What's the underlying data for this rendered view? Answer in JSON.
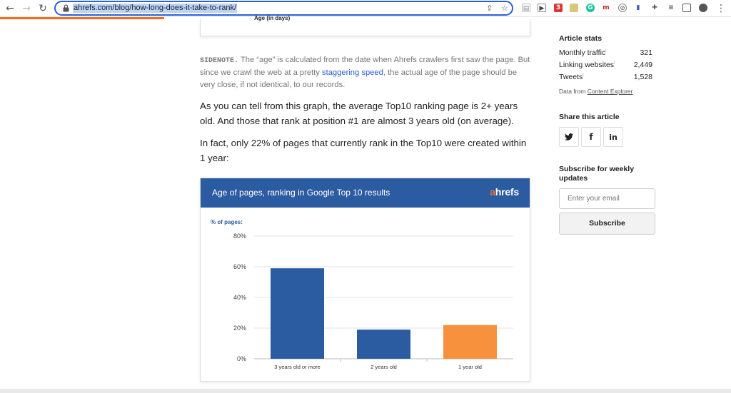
{
  "browser": {
    "url": "ahrefs.com/blog/how-long-does-it-take-to-rank/",
    "ext_badge": "3"
  },
  "figure_prev": {
    "xlabel": "Age (in days)"
  },
  "sidenote": {
    "tag": "SIDENOTE.",
    "text_before": " The “age” is calculated from the date when Ahrefs crawlers first saw the page. But since we crawl the web at a pretty ",
    "link": "staggering speed",
    "text_after": ", the actual age of the page should be very close, if not identical, to our records."
  },
  "article": {
    "p1": "As you can tell from this graph, the average Top10 ranking page is 2+ years old. And those that rank at position #1 are almost 3 years old (on average).",
    "p2": "In fact, only 22% of pages that currently rank in the Top10 were created within 1 year:"
  },
  "chart_header": {
    "title": "Age of pages, ranking in Google Top 10 results",
    "brand_a": "a",
    "brand_rest": "hrefs"
  },
  "chart_data": {
    "type": "bar",
    "title": "Age of pages, ranking in Google Top 10 results",
    "ylabel": "% of pages:",
    "xlabel": "",
    "categories": [
      "3 years old or more",
      "2 years old",
      "1 year old"
    ],
    "values": [
      59,
      19,
      22
    ],
    "colors": [
      "#2b5ba1",
      "#2b5ba1",
      "#f7913d"
    ],
    "yticks": [
      "0%",
      "20%",
      "40%",
      "60%",
      "80%"
    ],
    "ylim": [
      0,
      80
    ],
    "grid": true
  },
  "sidebar": {
    "stats_heading": "Article stats",
    "stats": [
      {
        "label": "Monthly traffic",
        "value": "321"
      },
      {
        "label": "Linking websites",
        "value": "2,449"
      },
      {
        "label": "Tweets",
        "value": "1,528"
      }
    ],
    "data_from_prefix": "Data from ",
    "data_from_link": "Content Explorer",
    "share_heading": "Share this article",
    "share_buttons": [
      "twitter-icon",
      "facebook-icon",
      "linkedin-icon"
    ],
    "subscribe_heading": "Subscribe for weekly updates",
    "email_placeholder": "Enter your email",
    "subscribe_label": "Subscribe"
  }
}
